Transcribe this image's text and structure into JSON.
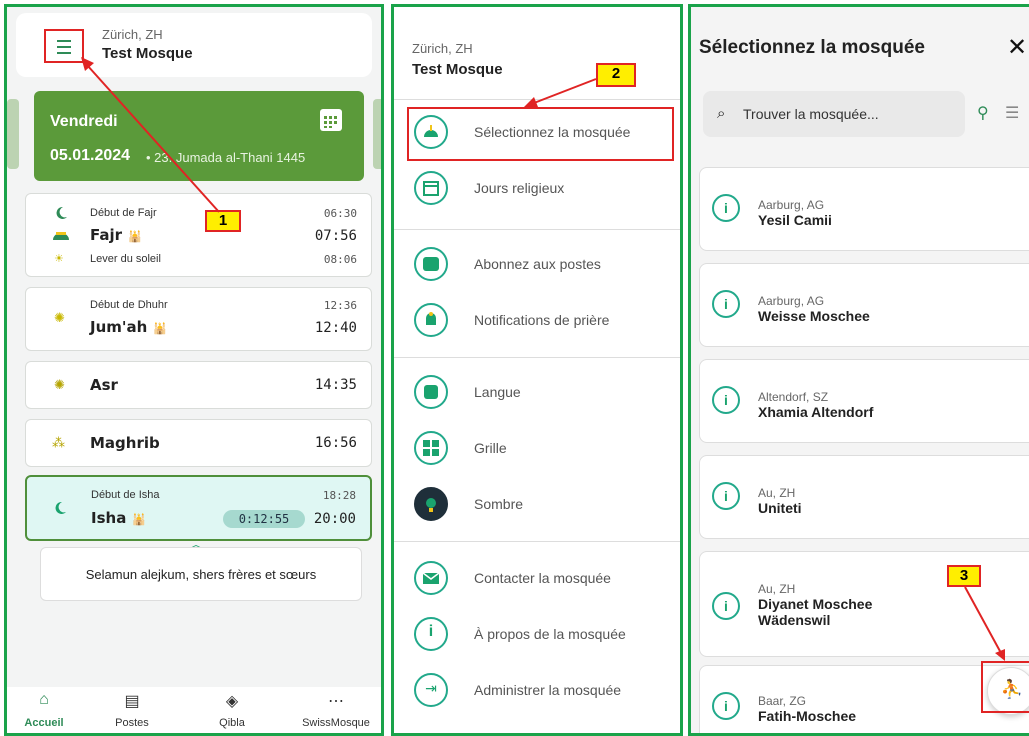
{
  "panel1": {
    "header": {
      "city": "Zürich, ZH",
      "mosque": "Test Mosque"
    },
    "day_card": {
      "day": "Vendredi",
      "date": "05.01.2024",
      "hijri": "• 23. Jumada al-Thani 1445"
    },
    "cards": {
      "fajr": {
        "start_label": "Début de Fajr",
        "start_time": "06:30",
        "name": "Fajr",
        "time": "07:56",
        "sunrise_label": "Lever du soleil",
        "sunrise_time": "08:06"
      },
      "dhuhr": {
        "start_label": "Début de Dhuhr",
        "start_time": "12:36",
        "name": "Jum'ah",
        "time": "12:40"
      },
      "asr": {
        "name": "Asr",
        "time": "14:35"
      },
      "maghrib": {
        "name": "Maghrib",
        "time": "16:56"
      },
      "isha": {
        "start_label": "Début de Isha",
        "start_time": "18:28",
        "name": "Isha",
        "countdown": "0:12:55",
        "time": "20:00"
      }
    },
    "greeting": "Selamun alejkum, shers frères et sœurs",
    "nav": [
      {
        "label": "Accueil",
        "icon": "home-icon"
      },
      {
        "label": "Postes",
        "icon": "document-icon"
      },
      {
        "label": "Qibla",
        "icon": "compass-icon"
      },
      {
        "label": "SwissMosque",
        "icon": "more-icon"
      }
    ]
  },
  "panel2": {
    "header": {
      "city": "Zürich, ZH",
      "mosque": "Test Mosque"
    },
    "menu": [
      {
        "label": "Sélectionnez la mosquée",
        "icon": "mosque-icon"
      },
      {
        "label": "Jours religieux",
        "icon": "calendar-icon"
      },
      {
        "label": "Abonnez aux postes",
        "icon": "subscribe-icon"
      },
      {
        "label": "Notifications de prière",
        "icon": "bell-icon"
      },
      {
        "label": "Langue",
        "icon": "language-icon"
      },
      {
        "label": "Grille",
        "icon": "grid-icon"
      },
      {
        "label": "Sombre",
        "icon": "lightbulb-icon"
      },
      {
        "label": "Contacter la mosquée",
        "icon": "mail-icon"
      },
      {
        "label": "À propos de la mosquée",
        "icon": "info-icon"
      },
      {
        "label": "Administrer la mosquée",
        "icon": "login-icon"
      }
    ]
  },
  "panel3": {
    "title": "Sélectionnez la mosquée",
    "close": "✕",
    "search_placeholder": "Trouver la mosquée...",
    "mosques": [
      {
        "city": "Aarburg, AG",
        "name": "Yesil Camii"
      },
      {
        "city": "Aarburg, AG",
        "name": "Weisse Moschee"
      },
      {
        "city": "Altendorf, SZ",
        "name": "Xhamia Altendorf"
      },
      {
        "city": "Au, ZH",
        "name": "Uniteti"
      },
      {
        "city": "Au, ZH",
        "name": "Diyanet Moschee",
        "name2": "Wädenswil"
      },
      {
        "city": "Baar, ZG",
        "name": "Fatih-Moschee"
      }
    ]
  },
  "annotations": [
    "1",
    "2",
    "3"
  ],
  "colors": {
    "accent_green": "#1aa34a",
    "day_card": "#5b9a3a",
    "annotation_red": "#e02424",
    "annotation_yellow": "#ffee00"
  }
}
